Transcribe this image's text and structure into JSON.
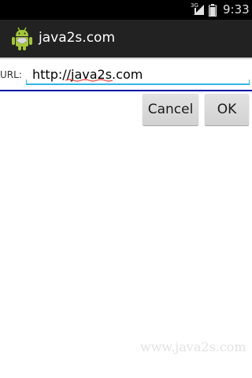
{
  "status_bar": {
    "network_type": "3G",
    "time": "9:33",
    "icons": [
      "signal-icon",
      "battery-icon"
    ]
  },
  "action_bar": {
    "title": "java2s.com",
    "icon": "android-icon"
  },
  "form": {
    "url_label": "URL:",
    "url_value": "http://java2s.com"
  },
  "buttons": {
    "cancel": "Cancel",
    "ok": "OK"
  },
  "watermark": "www.java2s.com",
  "colors": {
    "status_bar": "#000000",
    "action_bar": "#222222",
    "input_underline": "#33b5e5",
    "divider": "#0000aa",
    "button": "#d6d6d6"
  }
}
